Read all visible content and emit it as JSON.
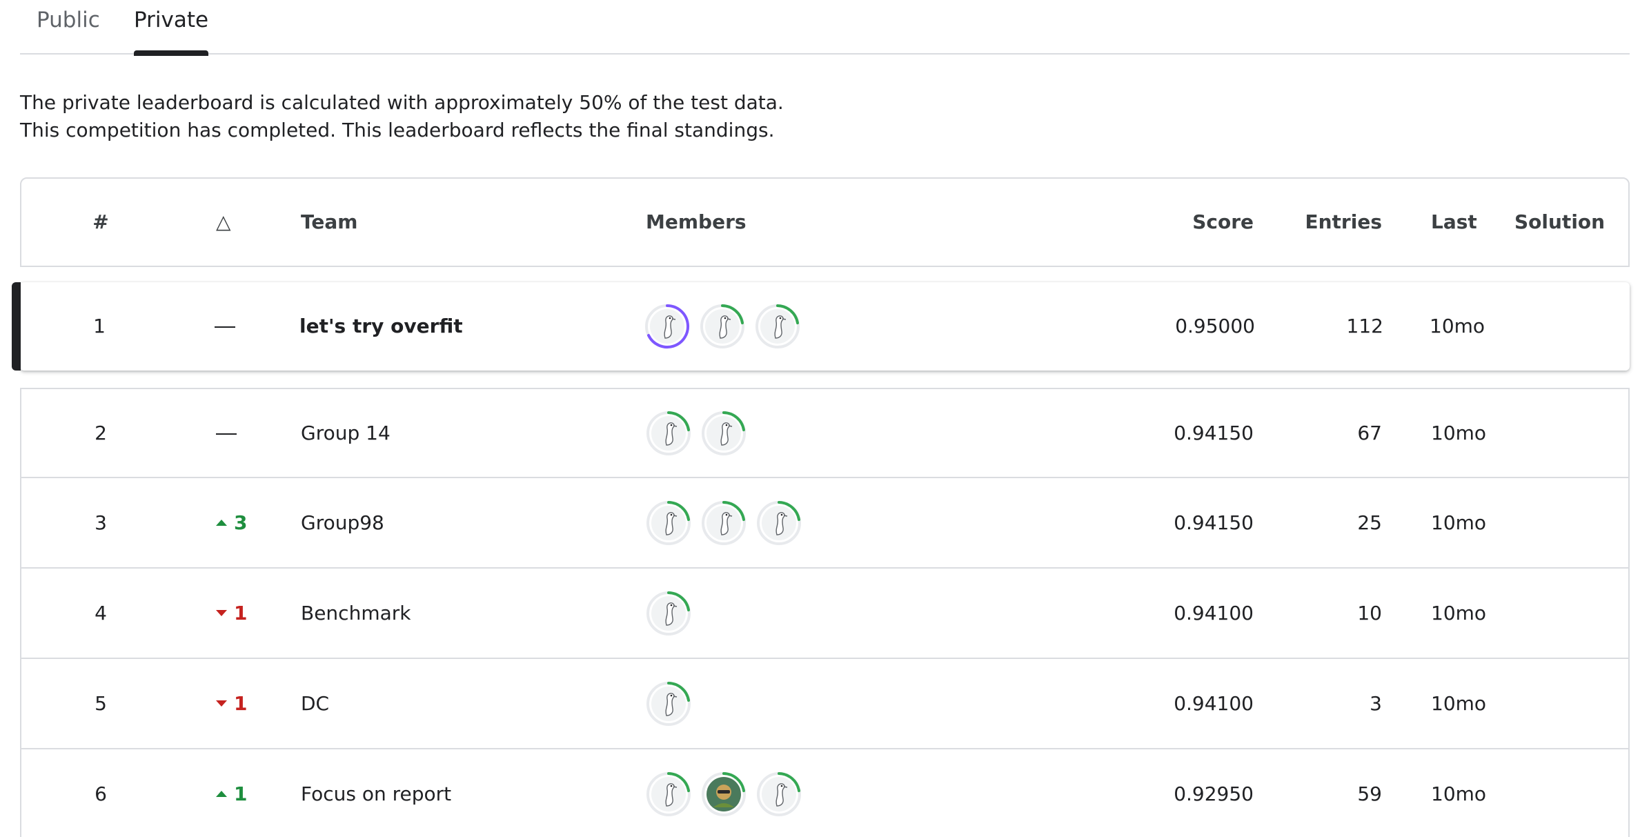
{
  "tabs": [
    {
      "label": "Public",
      "active": false
    },
    {
      "label": "Private",
      "active": true
    }
  ],
  "description": {
    "line1": "The private leaderboard is calculated with approximately 50% of the test data.",
    "line2": "This competition has completed. This leaderboard reflects the final standings."
  },
  "table": {
    "headers": {
      "rank": "#",
      "delta": "△",
      "team": "Team",
      "members": "Members",
      "score": "Score",
      "entries": "Entries",
      "last": "Last",
      "solution": "Solution"
    },
    "rows": [
      {
        "rank": "1",
        "delta_dir": "none",
        "delta": "",
        "team": "let's try overfit",
        "score": "0.95000",
        "entries": "112",
        "last": "10mo",
        "members": [
          "goose-purple",
          "goose-green",
          "goose-green"
        ],
        "highlight": true
      },
      {
        "rank": "2",
        "delta_dir": "none",
        "delta": "",
        "team": "Group 14",
        "score": "0.94150",
        "entries": "67",
        "last": "10mo",
        "members": [
          "goose-green",
          "goose-green"
        ]
      },
      {
        "rank": "3",
        "delta_dir": "up",
        "delta": "3",
        "team": "Group98",
        "score": "0.94150",
        "entries": "25",
        "last": "10mo",
        "members": [
          "goose-green",
          "goose-green",
          "goose-green"
        ]
      },
      {
        "rank": "4",
        "delta_dir": "down",
        "delta": "1",
        "team": "Benchmark",
        "score": "0.94100",
        "entries": "10",
        "last": "10mo",
        "members": [
          "goose-green"
        ]
      },
      {
        "rank": "5",
        "delta_dir": "down",
        "delta": "1",
        "team": "DC",
        "score": "0.94100",
        "entries": "3",
        "last": "10mo",
        "members": [
          "goose-green"
        ]
      },
      {
        "rank": "6",
        "delta_dir": "up",
        "delta": "1",
        "team": "Focus on report",
        "score": "0.92950",
        "entries": "59",
        "last": "10mo",
        "members": [
          "goose-green",
          "photo-green",
          "goose-green"
        ]
      }
    ]
  },
  "colors": {
    "ring_green": "#34a853",
    "ring_purple": "#7e57ff",
    "delta_up": "#1e8e3e",
    "delta_down": "#c5221f"
  }
}
